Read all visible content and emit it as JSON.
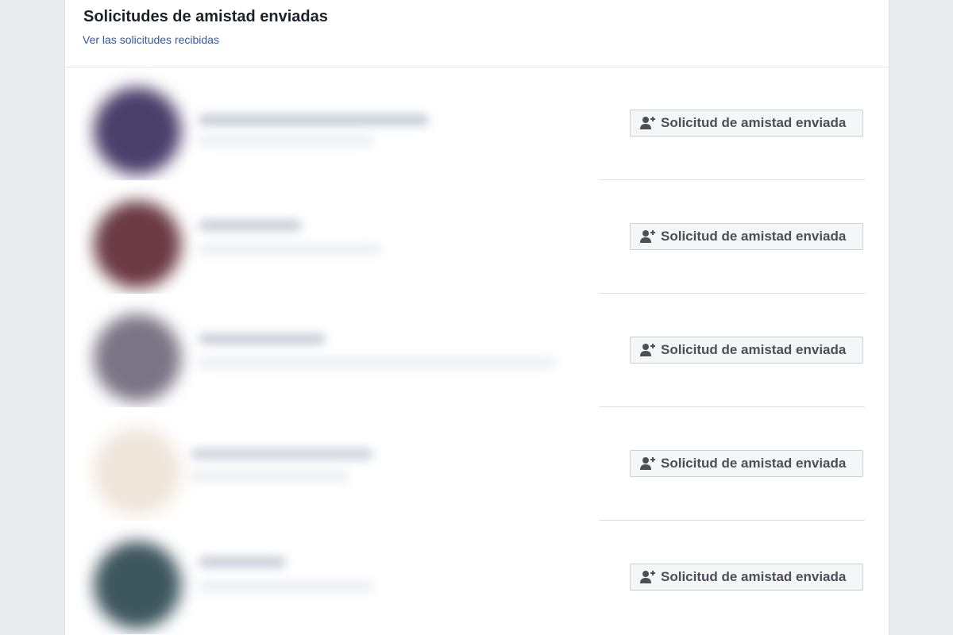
{
  "header": {
    "title": "Solicitudes de amistad enviadas",
    "link": "Ver las solicitudes recibidas"
  },
  "requests": [
    {
      "button_label": "Solicitud de amistad enviada",
      "icon": "person-add-icon",
      "avatar_color": "#4a3f6b"
    },
    {
      "button_label": "Solicitud de amistad enviada",
      "icon": "person-add-icon",
      "avatar_color": "#6b3a45"
    },
    {
      "button_label": "Solicitud de amistad enviada",
      "icon": "person-add-icon",
      "avatar_color": "#7a7585"
    },
    {
      "button_label": "Solicitud de amistad enviada",
      "icon": "person-add-icon",
      "avatar_color": "#efe6dc"
    },
    {
      "button_label": "Solicitud de amistad enviada",
      "icon": "person-add-icon",
      "avatar_color": "#3e565e"
    }
  ],
  "colors": {
    "page_background": "#e9ebee",
    "link": "#365899",
    "button_text": "#4b4f56",
    "button_background": "#f5f6f7"
  }
}
